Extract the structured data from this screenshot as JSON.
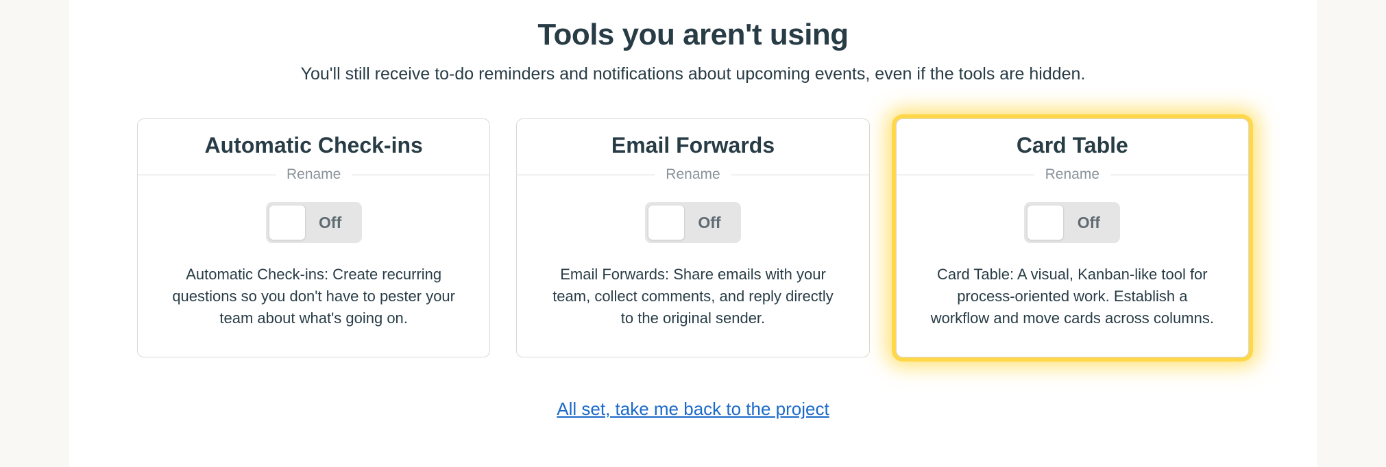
{
  "heading": "Tools you aren't using",
  "subheading": "You'll still receive to-do reminders and notifications about upcoming events, even if the tools are hidden.",
  "rename_label": "Rename",
  "toggle_off_label": "Off",
  "tools": [
    {
      "title": "Automatic Check-ins",
      "desc": "Automatic Check-ins: Create recurring questions so you don't have to pester your team about what's going on."
    },
    {
      "title": "Email Forwards",
      "desc": "Email Forwards: Share emails with your team, collect comments, and reply directly to the original sender."
    },
    {
      "title": "Card Table",
      "desc": "Card Table: A visual, Kanban-like tool for process-oriented work. Establish a workflow and move cards across columns."
    }
  ],
  "back_link": "All set, take me back to the project"
}
